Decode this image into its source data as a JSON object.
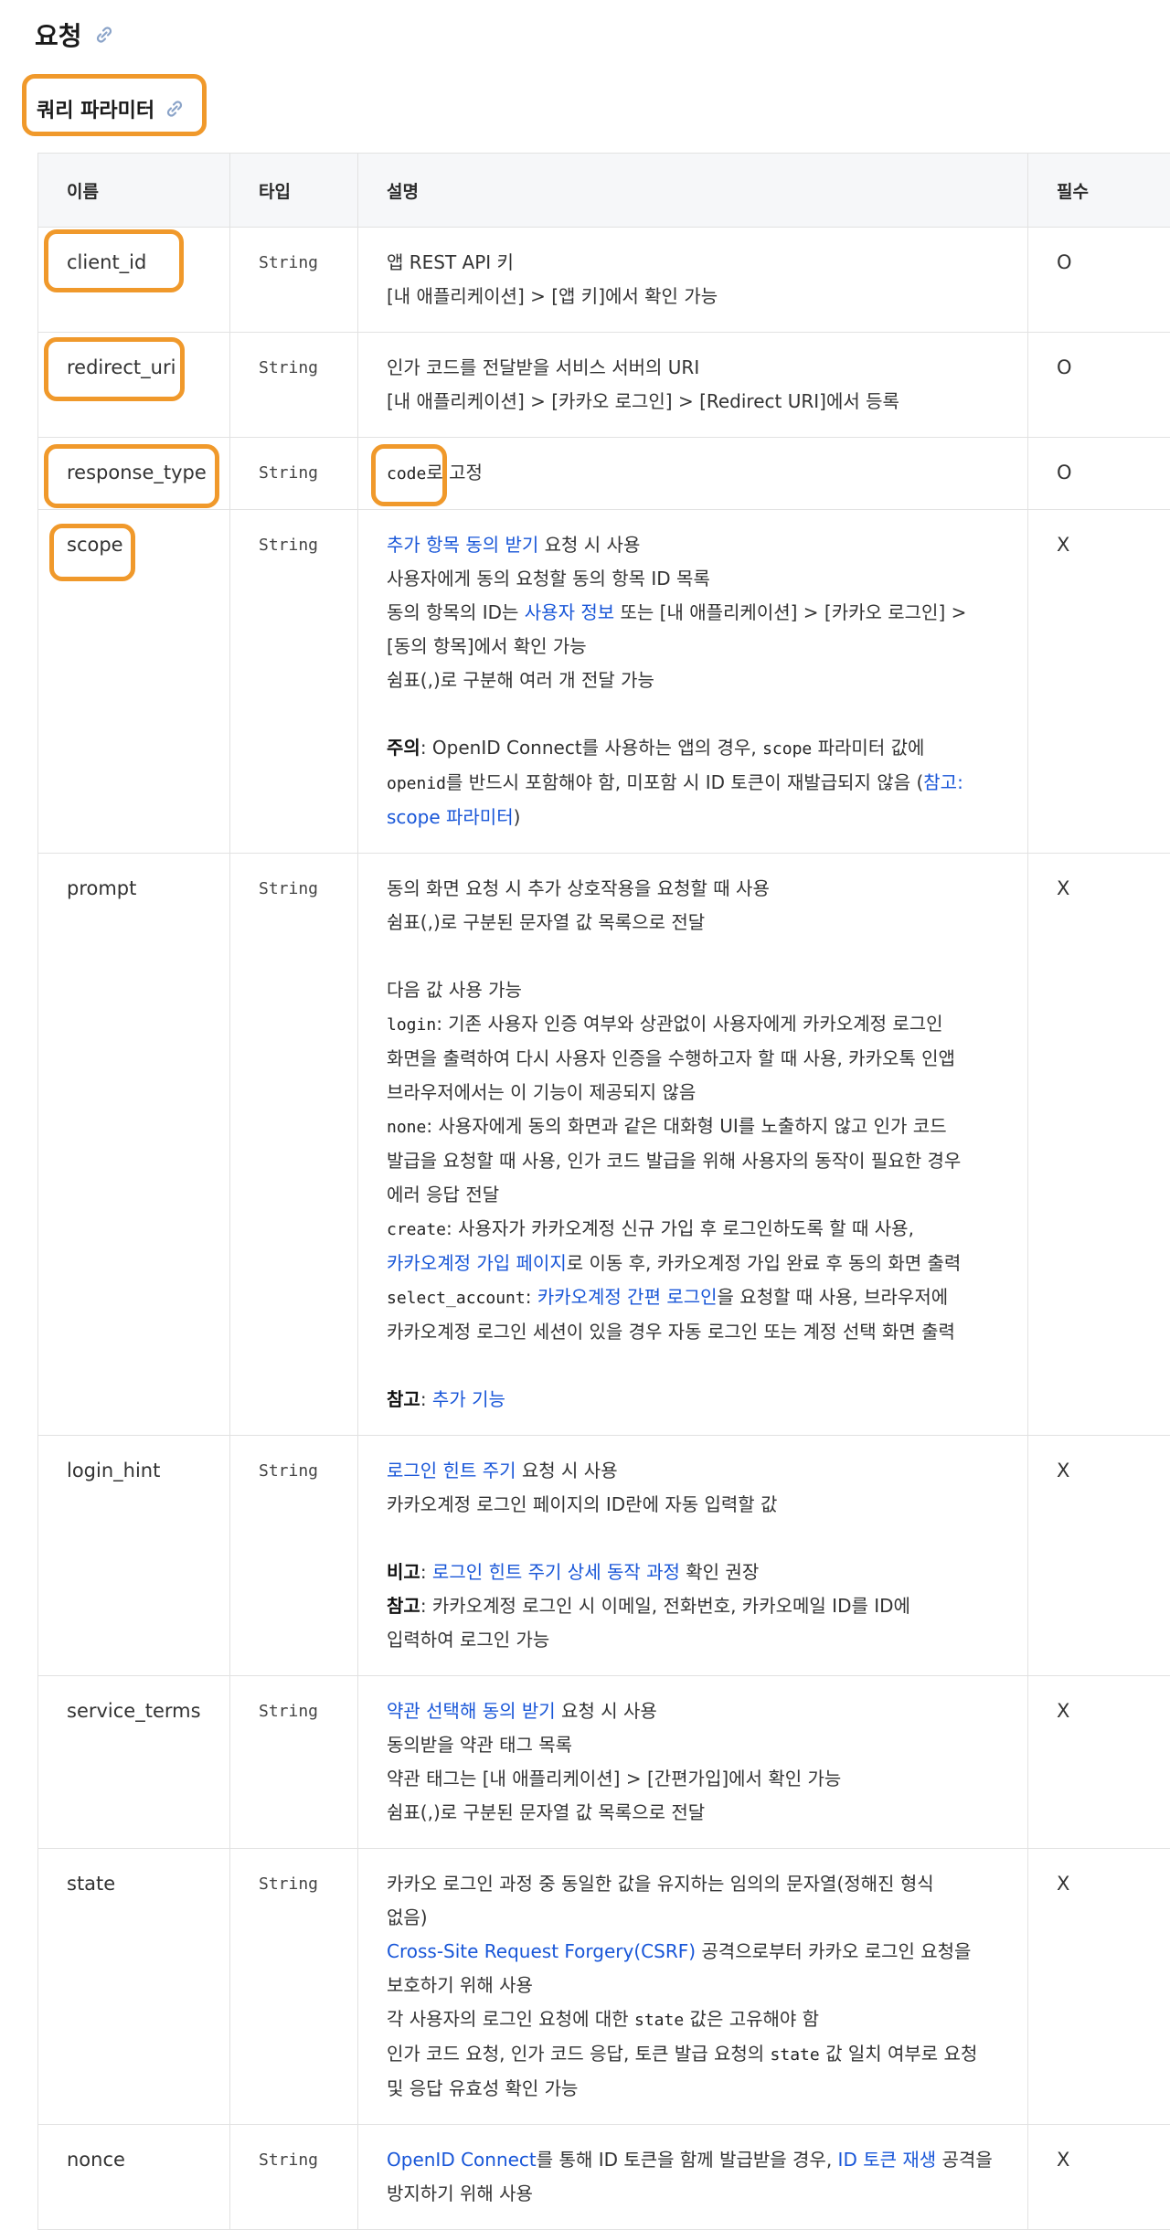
{
  "section_title": "요청",
  "subsection_title": "쿼리 파라미터",
  "table": {
    "headers": [
      "이름",
      "타입",
      "설명",
      "필수"
    ],
    "rows": [
      {
        "name": "client_id",
        "type": "String",
        "required": "O",
        "lines": [
          [
            {
              "t": "text",
              "v": "앱 REST API 키"
            }
          ],
          [
            {
              "t": "text",
              "v": "[내 애플리케이션] > [앱 키]에서 확인 가능"
            }
          ]
        ]
      },
      {
        "name": "redirect_uri",
        "type": "String",
        "required": "O",
        "lines": [
          [
            {
              "t": "text",
              "v": "인가 코드를 전달받을 서비스 서버의 URI"
            }
          ],
          [
            {
              "t": "text",
              "v": "[내 애플리케이션] > [카카오 로그인] > [Redirect URI]에서 등록"
            }
          ]
        ]
      },
      {
        "name": "response_type",
        "type": "String",
        "required": "O",
        "lines": [
          [
            {
              "t": "code",
              "v": "code"
            },
            {
              "t": "text",
              "v": "로 고정"
            }
          ]
        ]
      },
      {
        "name": "scope",
        "type": "String",
        "required": "X",
        "lines": [
          [
            {
              "t": "link",
              "v": "추가 항목 동의 받기"
            },
            {
              "t": "text",
              "v": " 요청 시 사용"
            }
          ],
          [
            {
              "t": "text",
              "v": "사용자에게 동의 요청할 동의 항목 ID 목록"
            }
          ],
          [
            {
              "t": "text",
              "v": "동의 항목의 ID는 "
            },
            {
              "t": "link",
              "v": "사용자 정보"
            },
            {
              "t": "text",
              "v": " 또는 [내 애플리케이션] > [카카오 로그인] >"
            }
          ],
          [
            {
              "t": "text",
              "v": "[동의 항목]에서 확인 가능"
            }
          ],
          [
            {
              "t": "text",
              "v": "쉼표(,)로 구분해 여러 개 전달 가능"
            }
          ],
          [],
          [
            {
              "t": "bold",
              "v": "주의"
            },
            {
              "t": "text",
              "v": ": OpenID Connect를 사용하는 앱의 경우, "
            },
            {
              "t": "code",
              "v": "scope"
            },
            {
              "t": "text",
              "v": " 파라미터 값에"
            }
          ],
          [
            {
              "t": "code",
              "v": "openid"
            },
            {
              "t": "text",
              "v": "를 반드시 포함해야 함, 미포함 시 ID 토큰이 재발급되지 않음 ("
            },
            {
              "t": "link",
              "v": "참고:"
            }
          ],
          [
            {
              "t": "link",
              "v": "scope 파라미터"
            },
            {
              "t": "text",
              "v": ")"
            }
          ]
        ]
      },
      {
        "name": "prompt",
        "type": "String",
        "required": "X",
        "lines": [
          [
            {
              "t": "text",
              "v": "동의 화면 요청 시 추가 상호작용을 요청할 때 사용"
            }
          ],
          [
            {
              "t": "text",
              "v": "쉼표(,)로 구분된 문자열 값 목록으로 전달"
            }
          ],
          [],
          [
            {
              "t": "text",
              "v": "다음 값 사용 가능"
            }
          ],
          [
            {
              "t": "code",
              "v": "login"
            },
            {
              "t": "text",
              "v": ": 기존 사용자 인증 여부와 상관없이 사용자에게 카카오계정 로그인"
            }
          ],
          [
            {
              "t": "text",
              "v": "화면을 출력하여 다시 사용자 인증을 수행하고자 할 때 사용, 카카오톡 인앱"
            }
          ],
          [
            {
              "t": "text",
              "v": "브라우저에서는 이 기능이 제공되지 않음"
            }
          ],
          [
            {
              "t": "code",
              "v": "none"
            },
            {
              "t": "text",
              "v": ": 사용자에게 동의 화면과 같은 대화형 UI를 노출하지 않고 인가 코드"
            }
          ],
          [
            {
              "t": "text",
              "v": "발급을 요청할 때 사용, 인가 코드 발급을 위해 사용자의 동작이 필요한 경우"
            }
          ],
          [
            {
              "t": "text",
              "v": "에러 응답 전달"
            }
          ],
          [
            {
              "t": "code",
              "v": "create"
            },
            {
              "t": "text",
              "v": ": 사용자가 카카오계정 신규 가입 후 로그인하도록 할 때 사용,"
            }
          ],
          [
            {
              "t": "link",
              "v": "카카오계정 가입 페이지"
            },
            {
              "t": "text",
              "v": "로 이동 후, 카카오계정 가입 완료 후 동의 화면 출력"
            }
          ],
          [
            {
              "t": "code",
              "v": "select_account"
            },
            {
              "t": "text",
              "v": ": "
            },
            {
              "t": "link",
              "v": "카카오계정 간편 로그인"
            },
            {
              "t": "text",
              "v": "을 요청할 때 사용, 브라우저에"
            }
          ],
          [
            {
              "t": "text",
              "v": "카카오계정 로그인 세션이 있을 경우 자동 로그인 또는 계정 선택 화면 출력"
            }
          ],
          [],
          [
            {
              "t": "bold",
              "v": "참고"
            },
            {
              "t": "text",
              "v": ": "
            },
            {
              "t": "link",
              "v": "추가 기능"
            }
          ]
        ]
      },
      {
        "name": "login_hint",
        "type": "String",
        "required": "X",
        "lines": [
          [
            {
              "t": "link",
              "v": "로그인 힌트 주기"
            },
            {
              "t": "text",
              "v": " 요청 시 사용"
            }
          ],
          [
            {
              "t": "text",
              "v": "카카오계정 로그인 페이지의 ID란에 자동 입력할 값"
            }
          ],
          [],
          [
            {
              "t": "bold",
              "v": "비고"
            },
            {
              "t": "text",
              "v": ": "
            },
            {
              "t": "link",
              "v": "로그인 힌트 주기 상세 동작 과정"
            },
            {
              "t": "text",
              "v": " 확인 권장"
            }
          ],
          [
            {
              "t": "bold",
              "v": "참고"
            },
            {
              "t": "text",
              "v": ": 카카오계정 로그인 시 이메일, 전화번호, 카카오메일 ID를 ID에"
            }
          ],
          [
            {
              "t": "text",
              "v": "입력하여 로그인 가능"
            }
          ]
        ]
      },
      {
        "name": "service_terms",
        "type": "String",
        "required": "X",
        "lines": [
          [
            {
              "t": "link",
              "v": "약관 선택해 동의 받기"
            },
            {
              "t": "text",
              "v": " 요청 시 사용"
            }
          ],
          [
            {
              "t": "text",
              "v": "동의받을 약관 태그 목록"
            }
          ],
          [
            {
              "t": "text",
              "v": "약관 태그는 [내 애플리케이션] > [간편가입]에서 확인 가능"
            }
          ],
          [
            {
              "t": "text",
              "v": "쉼표(,)로 구분된 문자열 값 목록으로 전달"
            }
          ]
        ]
      },
      {
        "name": "state",
        "type": "String",
        "required": "X",
        "lines": [
          [
            {
              "t": "text",
              "v": "카카오 로그인 과정 중 동일한 값을 유지하는 임의의 문자열(정해진 형식"
            }
          ],
          [
            {
              "t": "text",
              "v": "없음)"
            }
          ],
          [
            {
              "t": "link",
              "v": "Cross-Site Request Forgery(CSRF)"
            },
            {
              "t": "text",
              "v": " 공격으로부터 카카오 로그인 요청을"
            }
          ],
          [
            {
              "t": "text",
              "v": "보호하기 위해 사용"
            }
          ],
          [
            {
              "t": "text",
              "v": "각 사용자의 로그인 요청에 대한 "
            },
            {
              "t": "code",
              "v": "state"
            },
            {
              "t": "text",
              "v": " 값은 고유해야 함"
            }
          ],
          [
            {
              "t": "text",
              "v": "인가 코드 요청, 인가 코드 응답, 토큰 발급 요청의 "
            },
            {
              "t": "code",
              "v": "state"
            },
            {
              "t": "text",
              "v": " 값 일치 여부로 요청"
            }
          ],
          [
            {
              "t": "text",
              "v": "및 응답 유효성 확인 가능"
            }
          ]
        ]
      },
      {
        "name": "nonce",
        "type": "String",
        "required": "X",
        "lines": [
          [
            {
              "t": "link",
              "v": "OpenID Connect"
            },
            {
              "t": "text",
              "v": "를 통해 ID 토큰을 함께 발급받을 경우, "
            },
            {
              "t": "link",
              "v": "ID 토큰 재생"
            },
            {
              "t": "text",
              "v": " 공격을"
            }
          ],
          [
            {
              "t": "text",
              "v": "방지하기 위해 사용"
            }
          ]
        ]
      }
    ]
  },
  "colors": {
    "highlight": "#f0992b",
    "link": "#1856d8",
    "header_bg": "#f6f7f9",
    "border": "#e2e2e2"
  },
  "icons": {
    "anchor": "link-icon"
  }
}
